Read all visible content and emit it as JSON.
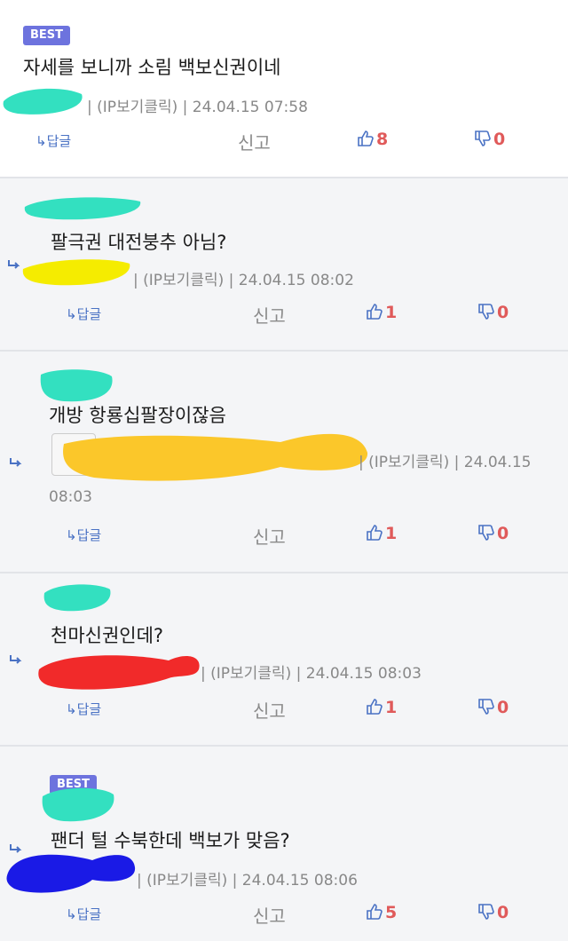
{
  "labels": {
    "best": "BEST",
    "reply": "답글",
    "report": "신고",
    "ip": "(IP보기클릭)"
  },
  "comments": [
    {
      "text": "자세를 보니까 소림 백보신권이네",
      "date": "24.04.15 07:58",
      "up": "8",
      "down": "0",
      "best": true
    },
    {
      "text": "팔극권 대전붕추 아님?",
      "date": "24.04.15 08:02",
      "up": "1",
      "down": "0"
    },
    {
      "text": "개방 항룡십팔장이잖음",
      "date": "24.04.15",
      "date2": "08:03",
      "up": "1",
      "down": "0"
    },
    {
      "text": "천마신권인데?",
      "date": "24.04.15 08:03",
      "up": "1",
      "down": "0"
    },
    {
      "text": "팬더 털 수북한데 백보가 맞음?",
      "date": "24.04.15 08:06",
      "up": "5",
      "down": "0",
      "best": true
    }
  ],
  "colors": {
    "accent": "#6d73de",
    "vote": "#e05a5a",
    "link": "#4a72c4"
  }
}
